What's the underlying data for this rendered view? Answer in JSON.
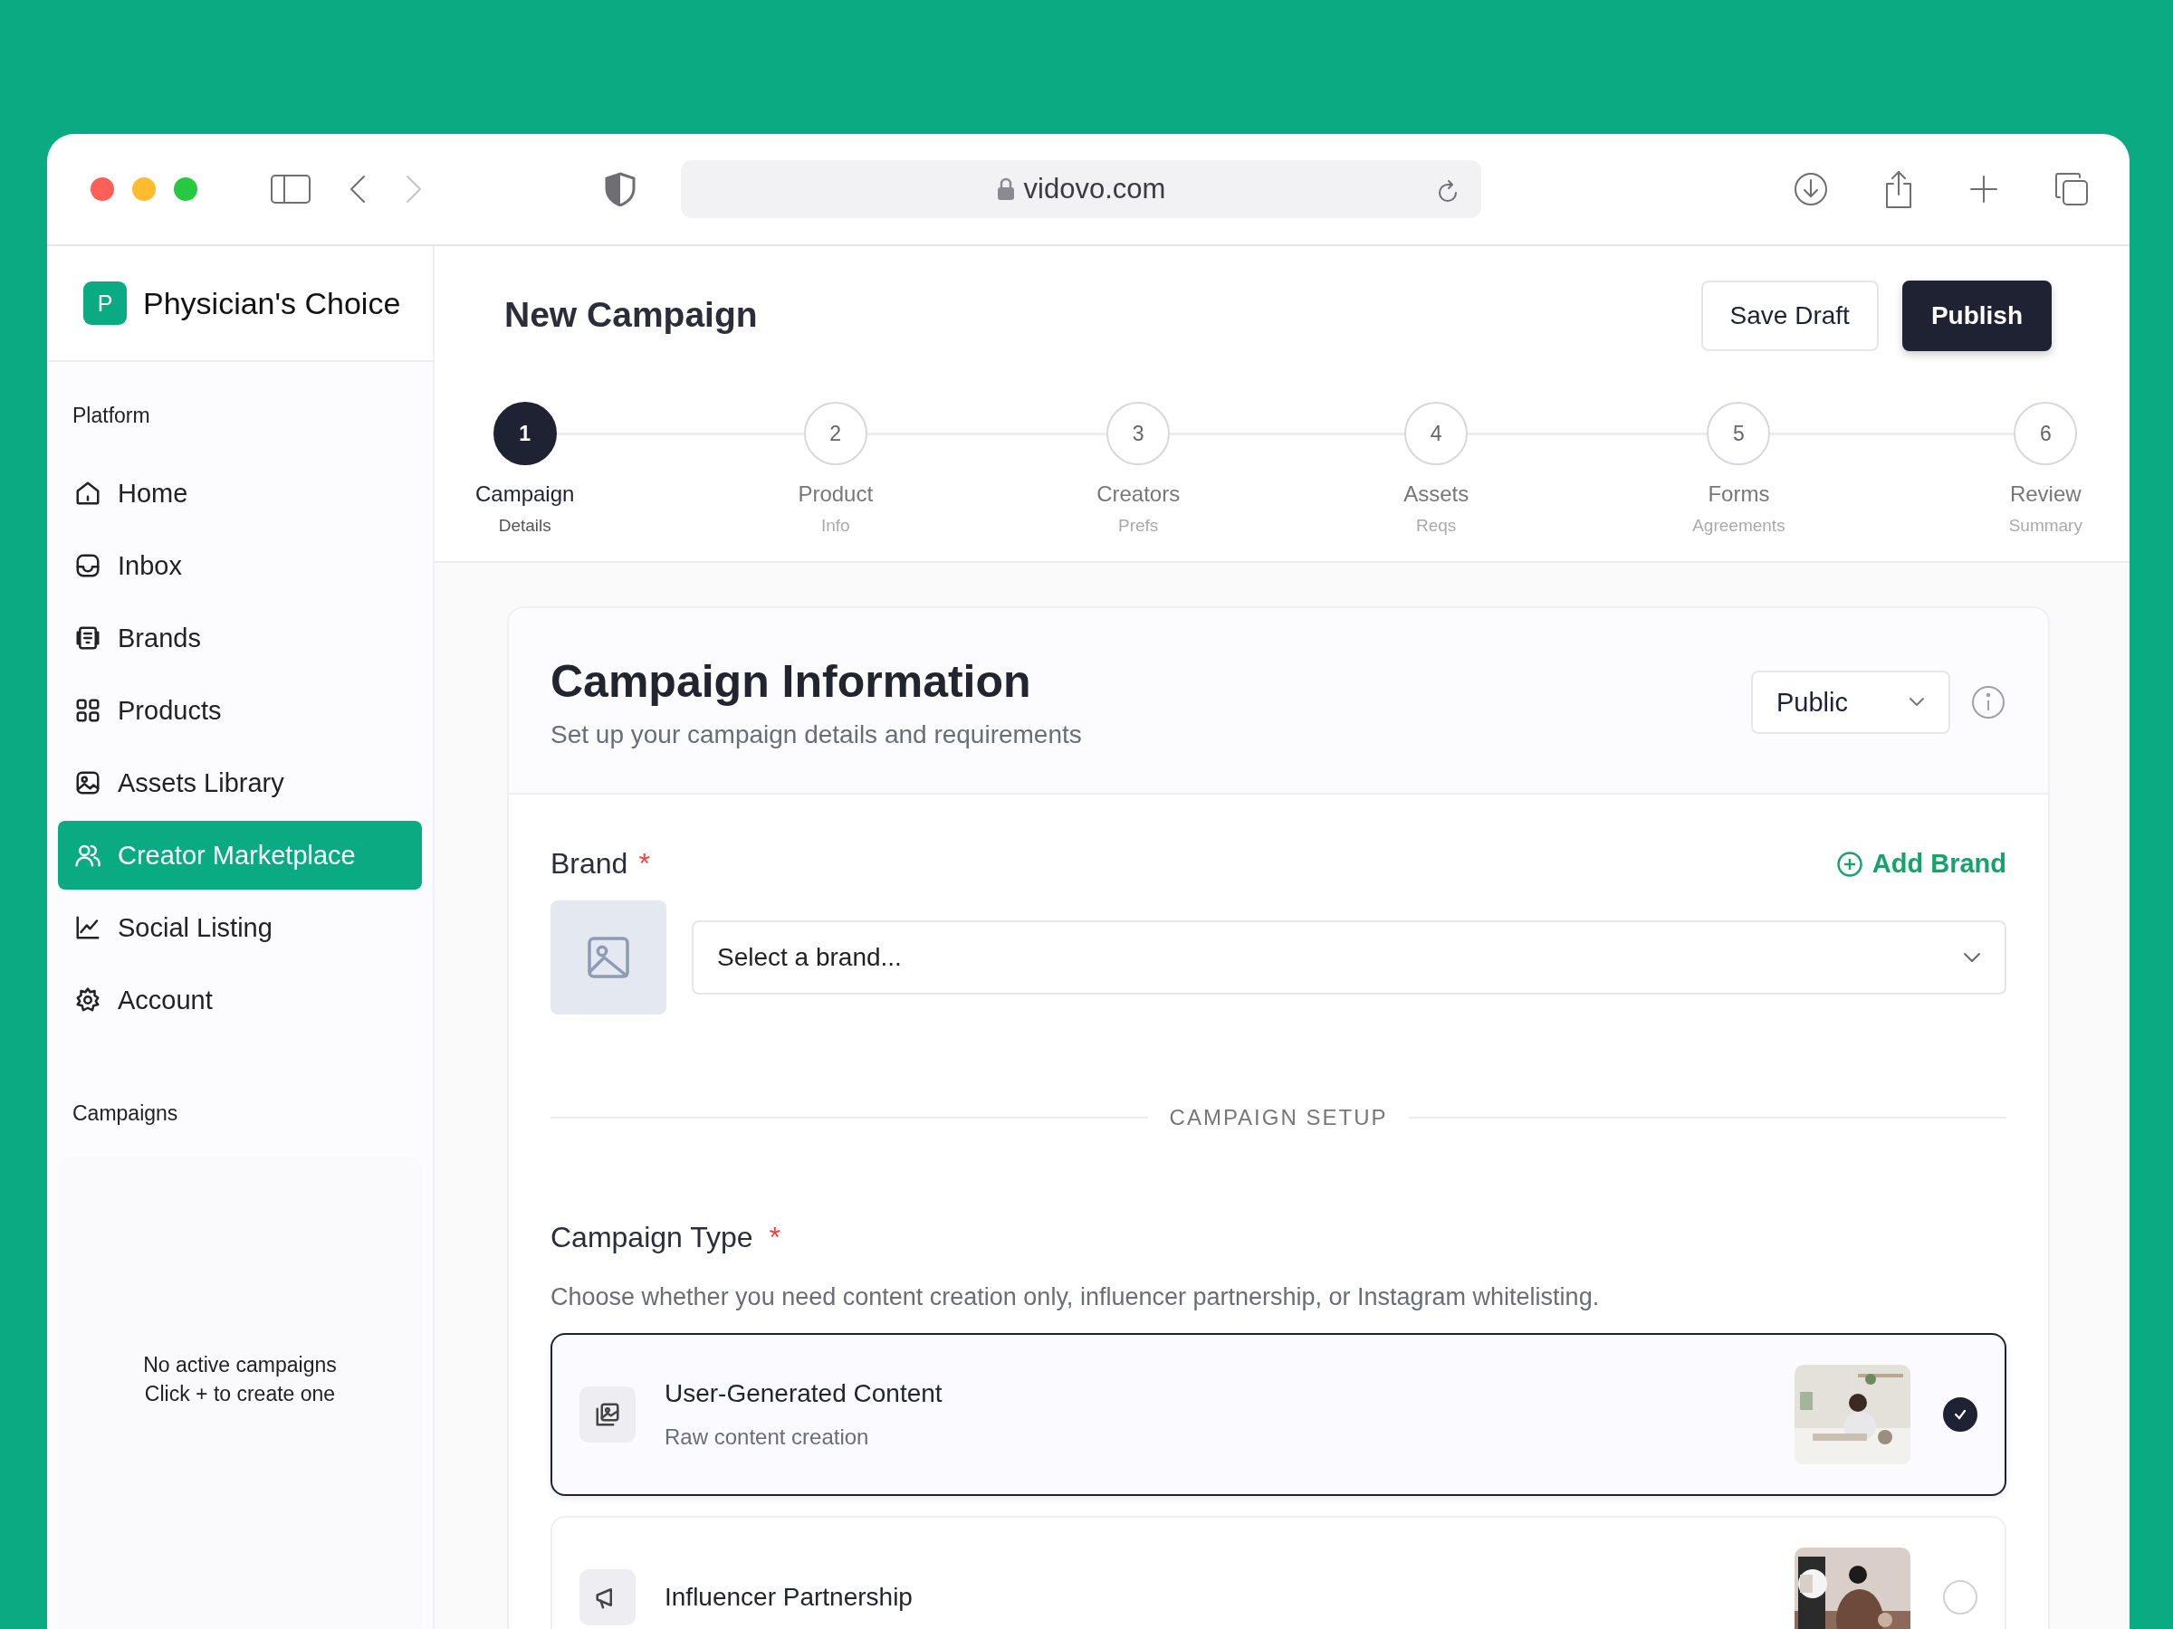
{
  "browser": {
    "url": "vidovo.com",
    "forward_disabled": true
  },
  "sidebar": {
    "logo_letter": "P",
    "brand": "Physician's Choice",
    "section": "Platform",
    "items": [
      {
        "label": "Home",
        "selected": false
      },
      {
        "label": "Inbox",
        "selected": false
      },
      {
        "label": "Brands",
        "selected": false
      },
      {
        "label": "Products",
        "selected": false
      },
      {
        "label": "Assets Library",
        "selected": false
      },
      {
        "label": "Creator Marketplace",
        "selected": true
      },
      {
        "label": "Social Listing",
        "selected": false
      },
      {
        "label": "Account",
        "selected": false
      }
    ],
    "campaigns_heading": "Campaigns",
    "empty_lines": [
      "No active campaigns",
      "Click + to create one"
    ]
  },
  "header": {
    "title": "New Campaign",
    "buttons": [
      {
        "label": "Save Draft",
        "kind": "secondary"
      },
      {
        "label": "Publish",
        "kind": "primary"
      }
    ]
  },
  "steps": [
    {
      "number": "1",
      "label": "Campaign",
      "sub": "Details",
      "selected": true
    },
    {
      "number": "2",
      "label": "Product",
      "sub": "Info",
      "selected": false
    },
    {
      "number": "3",
      "label": "Creators",
      "sub": "Prefs",
      "selected": false
    },
    {
      "number": "4",
      "label": "Assets",
      "sub": "Reqs",
      "selected": false
    },
    {
      "number": "5",
      "label": "Forms",
      "sub": "Agreements",
      "selected": false
    },
    {
      "number": "6",
      "label": "Review",
      "sub": "Summary",
      "selected": false
    }
  ],
  "card": {
    "title": "Campaign Information",
    "subtitle": "Set up your campaign details and requirements",
    "visibility": "Public",
    "brand": {
      "label": "Brand",
      "required_mark": "*",
      "add": "Add Brand",
      "placeholder": "Select a brand..."
    },
    "divider": "CAMPAIGN SETUP",
    "campaign_type": {
      "label": "Campaign Type",
      "required_mark": "*",
      "hint": "Choose whether you need content creation only, influencer partnership, or Instagram whitelisting.",
      "options": [
        {
          "title": "User-Generated Content",
          "subtitle": "Raw content creation",
          "selected": true
        },
        {
          "title": "Influencer Partnership",
          "selected": false
        }
      ]
    }
  }
}
